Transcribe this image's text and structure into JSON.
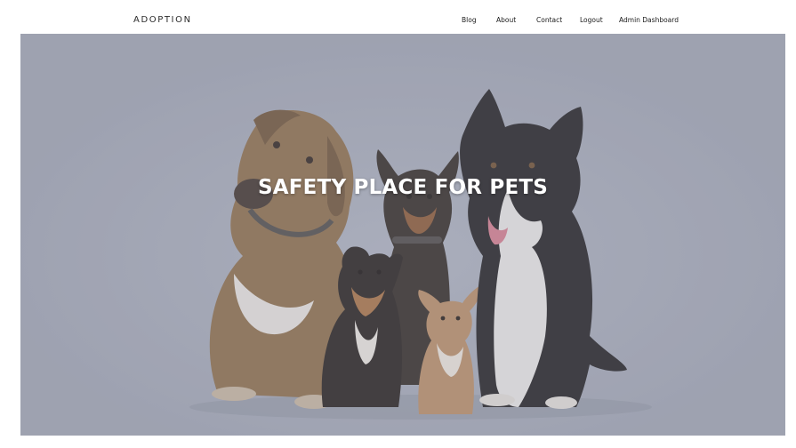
{
  "navbar": {
    "brand": "ADOPTION",
    "links": [
      {
        "label": "Blog"
      },
      {
        "label": "About"
      },
      {
        "label": "Contact"
      },
      {
        "label": "Logout"
      },
      {
        "label": "Admin Dashboard"
      }
    ]
  },
  "hero": {
    "title": "SAFETY PLACE FOR PETS",
    "image": "dogs-group-photo",
    "overlay_color": "#9ea2b1"
  },
  "colors": {
    "text": "#1a1a1a",
    "hero_text": "#ffffff",
    "background": "#ffffff"
  }
}
